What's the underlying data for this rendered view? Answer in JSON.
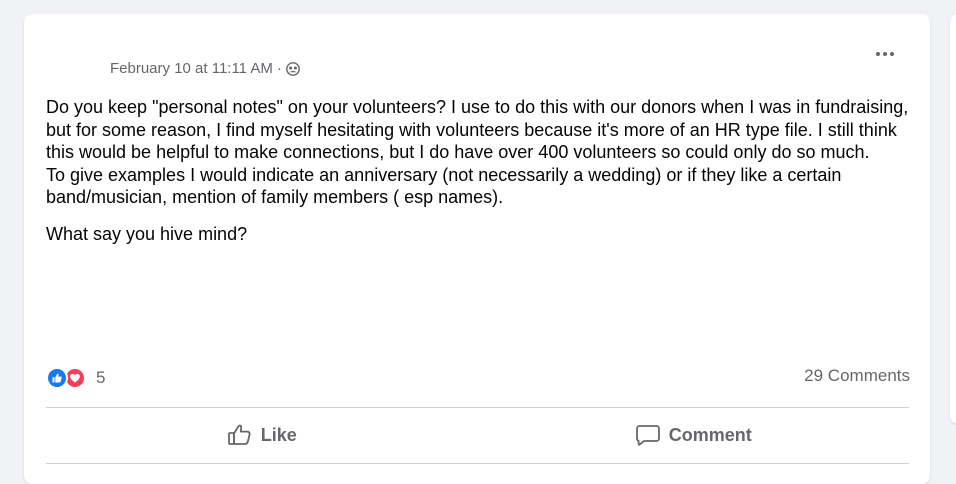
{
  "post": {
    "timestamp": "February 10 at 11:11 AM",
    "separator": "·",
    "audience_icon": "members-group-icon",
    "more_icon": "more-options-icon",
    "paragraphs": [
      "Do you keep \"personal notes\" on your volunteers?  I use to do this with our donors when I was in fundraising, but for some reason, I find myself hesitating with volunteers because it's more of an HR type file. I still think this would be helpful to make connections, but I do have over 400 volunteers so could only do so much.",
      "To give examples I would indicate an anniversary (not necessarily a wedding) or if they like a certain band/musician, mention of family members ( esp names).",
      "What say you hive mind?"
    ]
  },
  "reactions": {
    "icons": [
      "like-reaction-icon",
      "love-reaction-icon"
    ],
    "count": "5",
    "comments_label": "29 Comments"
  },
  "actions": {
    "like_label": "Like",
    "comment_label": "Comment"
  },
  "colors": {
    "like_blue": "#1877f2",
    "love_red": "#f33e58",
    "secondary_text": "#65676b",
    "primary_text": "#050505"
  }
}
